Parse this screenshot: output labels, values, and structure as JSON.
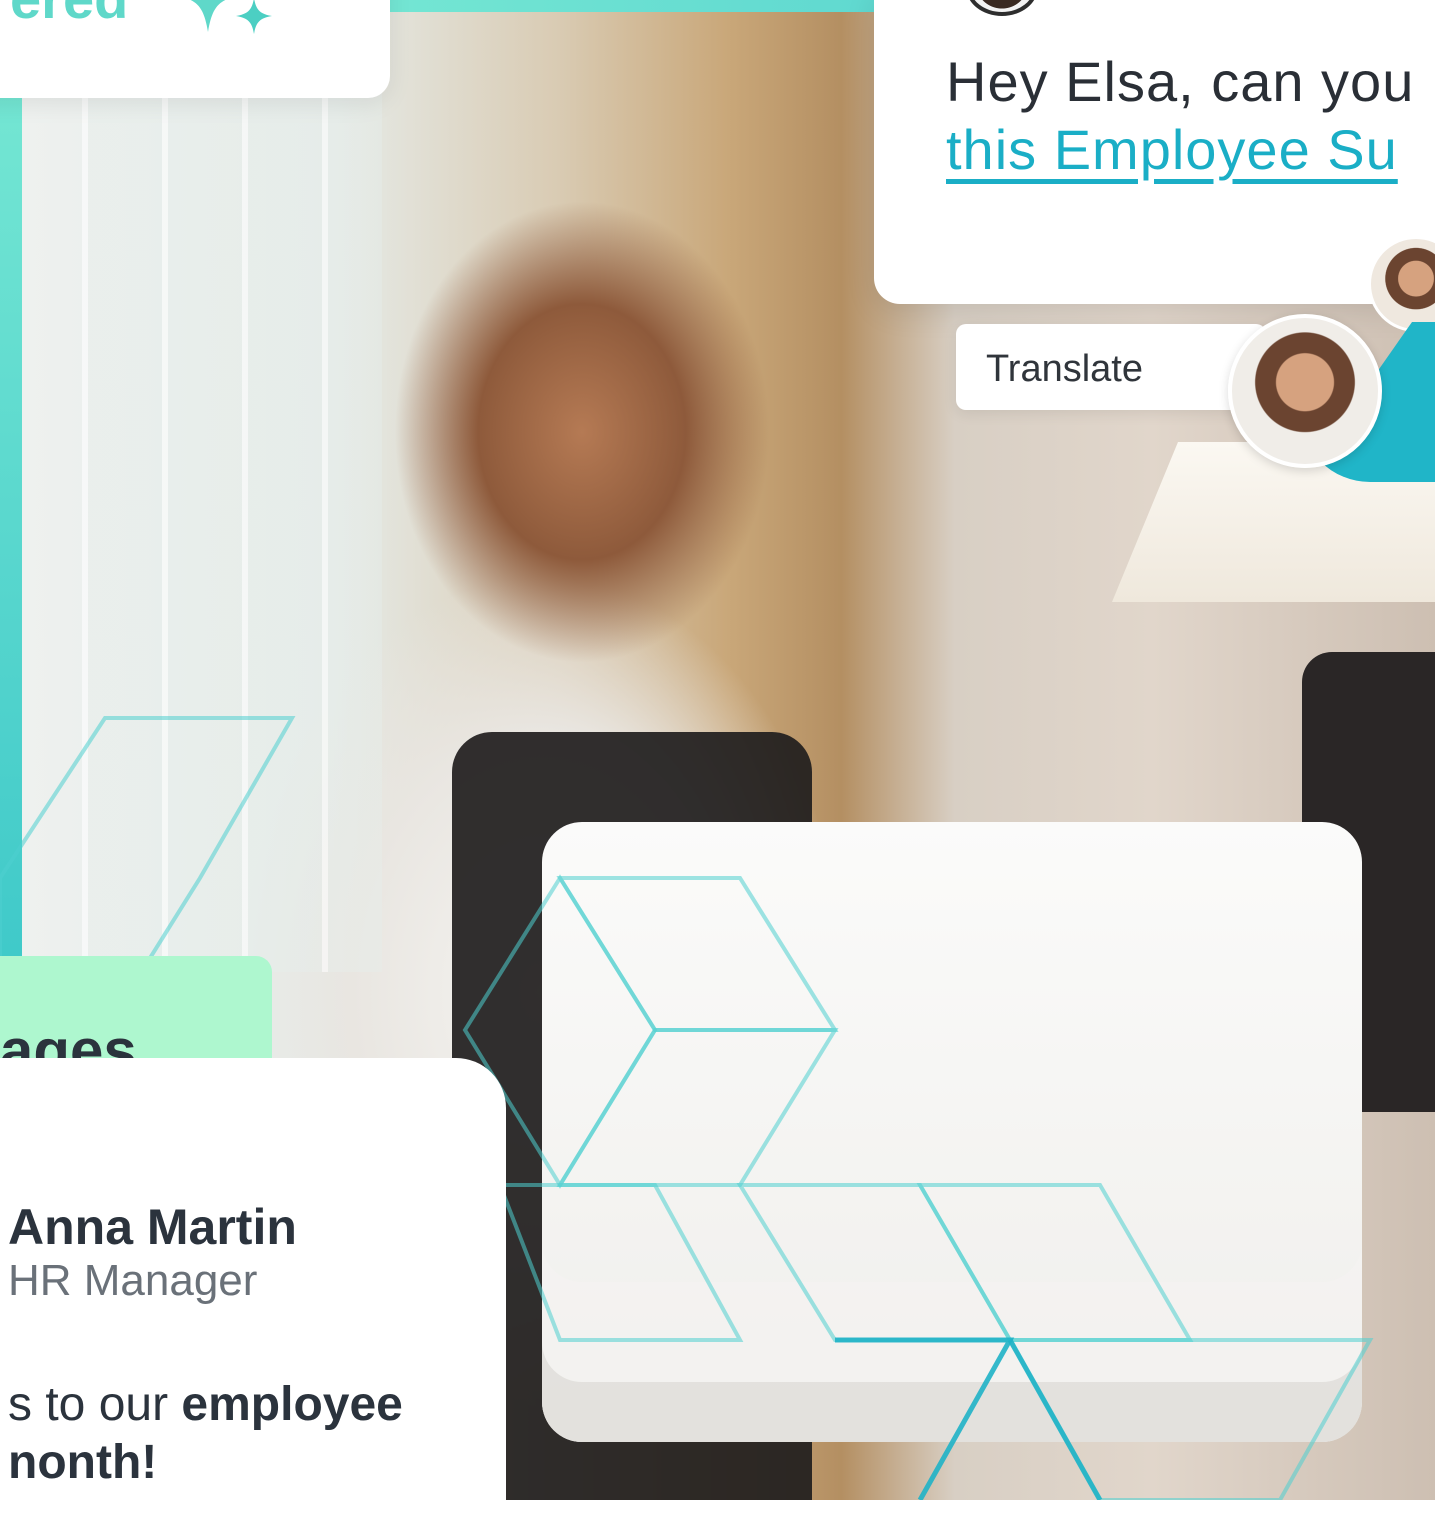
{
  "brand": {
    "partial_word": "ered",
    "accent": "#5fd8c9",
    "link_color": "#1aaec6",
    "pill_color": "#aef7cf",
    "teal": "#20b5c8"
  },
  "chat": {
    "line1": "Hey Elsa, can you",
    "link": "this Employee Su"
  },
  "translate": {
    "label": "Translate"
  },
  "section_pill": {
    "label": "ages"
  },
  "message": {
    "sender_name": "Anna Martin",
    "sender_role": "HR Manager",
    "body_lead": "s to our ",
    "body_bold1": "employee",
    "body_bold2": "nonth!"
  },
  "icons": [
    "sparkle-icon",
    "avatar"
  ]
}
